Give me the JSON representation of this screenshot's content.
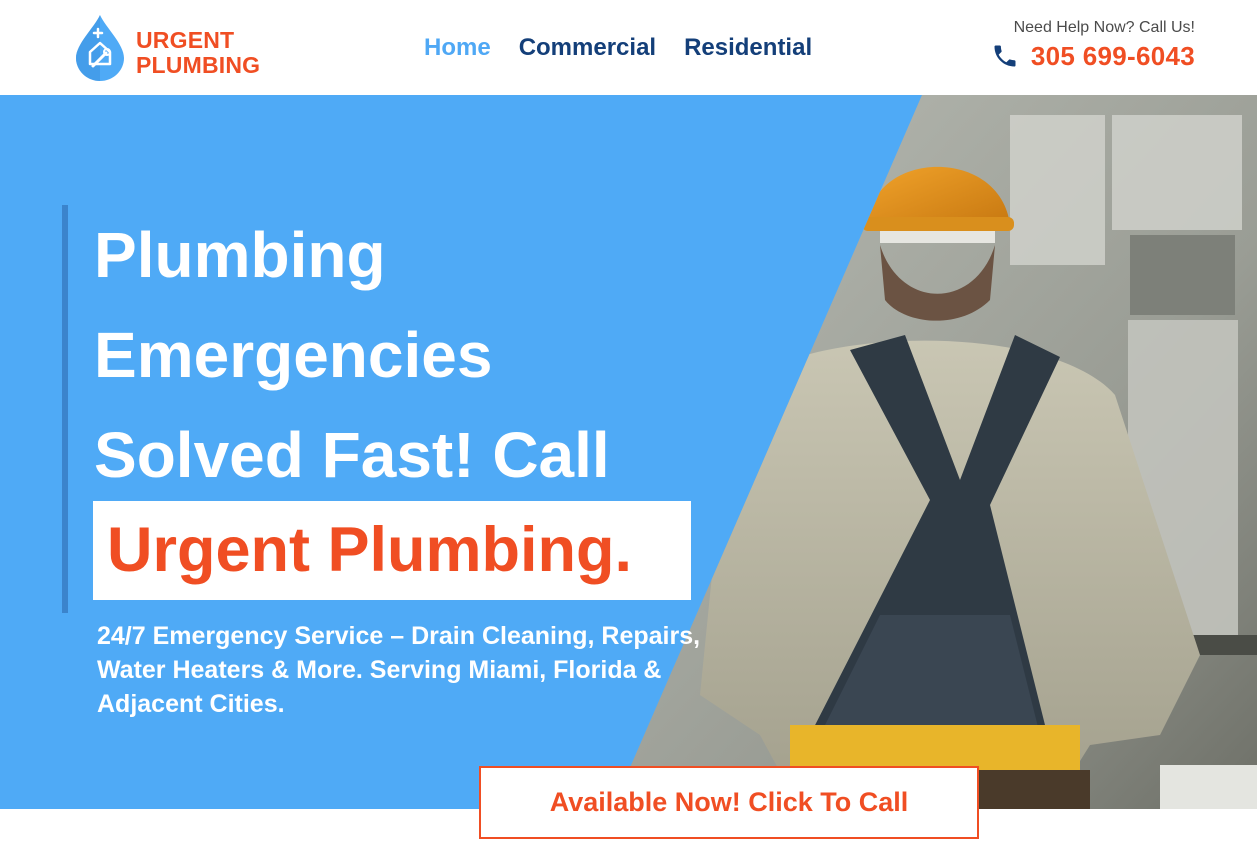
{
  "brand": {
    "name_line1": "URGENT",
    "name_line2": "PLUMBING",
    "primary_color": "#4faaf6",
    "accent_color": "#f04e23",
    "nav_color": "#143f79"
  },
  "nav": {
    "items": [
      {
        "label": "Home",
        "active": true
      },
      {
        "label": "Commercial",
        "active": false
      },
      {
        "label": "Residential",
        "active": false
      }
    ]
  },
  "contact": {
    "help_label": "Need Help Now? Call Us!",
    "phone": "305 699-6043",
    "phone_icon": "phone-icon"
  },
  "hero": {
    "headline_lines": [
      "Plumbing",
      "Emergencies",
      "Solved Fast! Call"
    ],
    "highlight": "Urgent Plumbing.",
    "subtext": "24/7 Emergency Service – Drain Cleaning, Repairs, Water Heaters & More. Serving Miami, Florida & Adjacent Cities.",
    "image": "plumber-hard-hat-photo"
  },
  "cta": {
    "label": "Available Now! Click To Call"
  }
}
